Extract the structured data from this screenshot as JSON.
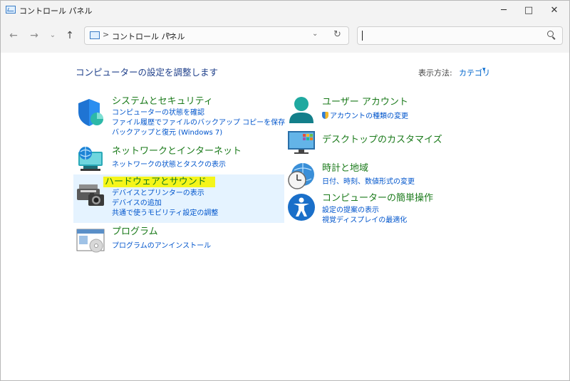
{
  "window": {
    "title": "コントロール パネル",
    "controls": {
      "minimize": "─",
      "maximize": "□",
      "close": "✕"
    }
  },
  "navigation": {
    "back_icon": "←",
    "forward_icon": "→",
    "recent_icon": "⌄",
    "up_icon": "↑",
    "breadcrumb": "コントロール パネル",
    "separator": ">",
    "dropdown_icon": "⌄",
    "refresh_icon": "↻",
    "search_value": ""
  },
  "main": {
    "heading": "コンピューターの設定を調整します",
    "view_by_label": "表示方法:",
    "view_by_value": "カテゴリ",
    "view_by_caret": "▾"
  },
  "categories": {
    "system_security": {
      "title": "システムとセキュリティ",
      "links": [
        "コンピューターの状態を確認",
        "ファイル履歴でファイルのバックアップ コピーを保存",
        "バックアップと復元 (Windows 7)"
      ]
    },
    "network": {
      "title": "ネットワークとインターネット",
      "links": [
        "ネットワークの状態とタスクの表示"
      ]
    },
    "hardware": {
      "title": "ハードウェアとサウンド",
      "links": [
        "デバイスとプリンターの表示",
        "デバイスの追加",
        "共通で使うモビリティ設定の調整"
      ]
    },
    "programs": {
      "title": "プログラム",
      "links": [
        "プログラムのアンインストール"
      ]
    },
    "user_accounts": {
      "title": "ユーザー アカウント",
      "links": [
        "アカウントの種類の変更"
      ]
    },
    "appearance": {
      "title": "デスクトップのカスタマイズ",
      "links": []
    },
    "clock_region": {
      "title": "時計と地域",
      "links": [
        "日付、時刻、数値形式の変更"
      ]
    },
    "ease_of_access": {
      "title": "コンピューターの簡単操作",
      "links": [
        "設定の提案の表示",
        "視覚ディスプレイの最適化"
      ]
    }
  },
  "colors": {
    "category_title": "#1a7a1a",
    "link": "#0055cc",
    "heading": "#1e3f8a",
    "highlight": "#f5f51a",
    "hover_background": "#e5f3ff"
  }
}
